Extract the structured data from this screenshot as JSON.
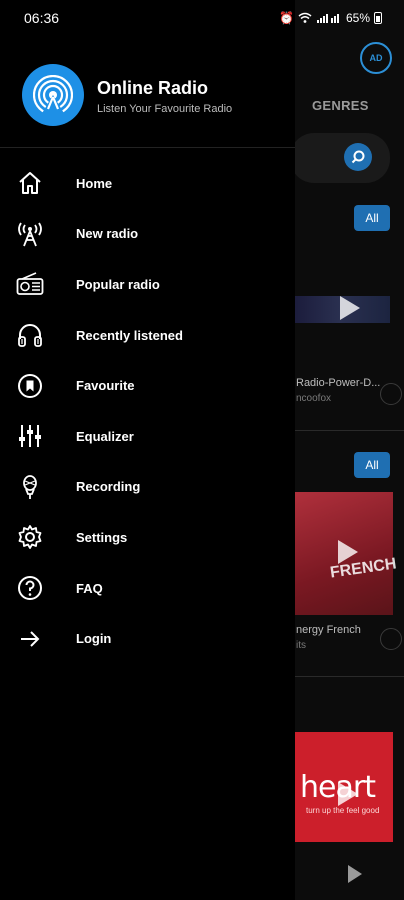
{
  "status_bar": {
    "time": "06:36",
    "battery": "65%"
  },
  "drawer": {
    "app_title": "Online Radio",
    "app_subtitle": "Listen Your Favourite Radio",
    "accent_color": "#1e90e6",
    "menu": [
      {
        "label": "Home",
        "icon": "home-icon"
      },
      {
        "label": "New radio",
        "icon": "antenna-icon"
      },
      {
        "label": "Popular radio",
        "icon": "radio-icon"
      },
      {
        "label": "Recently listened",
        "icon": "headphones-icon"
      },
      {
        "label": "Favourite",
        "icon": "bookmark-icon"
      },
      {
        "label": "Equalizer",
        "icon": "equalizer-icon"
      },
      {
        "label": "Recording",
        "icon": "microphone-icon"
      },
      {
        "label": "Settings",
        "icon": "gear-icon"
      },
      {
        "label": "FAQ",
        "icon": "question-icon"
      },
      {
        "label": "Login",
        "icon": "arrow-right-icon"
      }
    ]
  },
  "background": {
    "ad_label": "AD",
    "genres_tab": "GENRES",
    "all_button_1": "All",
    "all_button_2": "All",
    "card1_title": "Radio-Power-D...",
    "card1_subtitle": "ncoofox",
    "card2_title": "nergy French",
    "card2_subtitle": "its",
    "card2_art_text": "FRENCH",
    "card3_art_text": "heart",
    "card3_art_sub": "turn up the feel good"
  }
}
